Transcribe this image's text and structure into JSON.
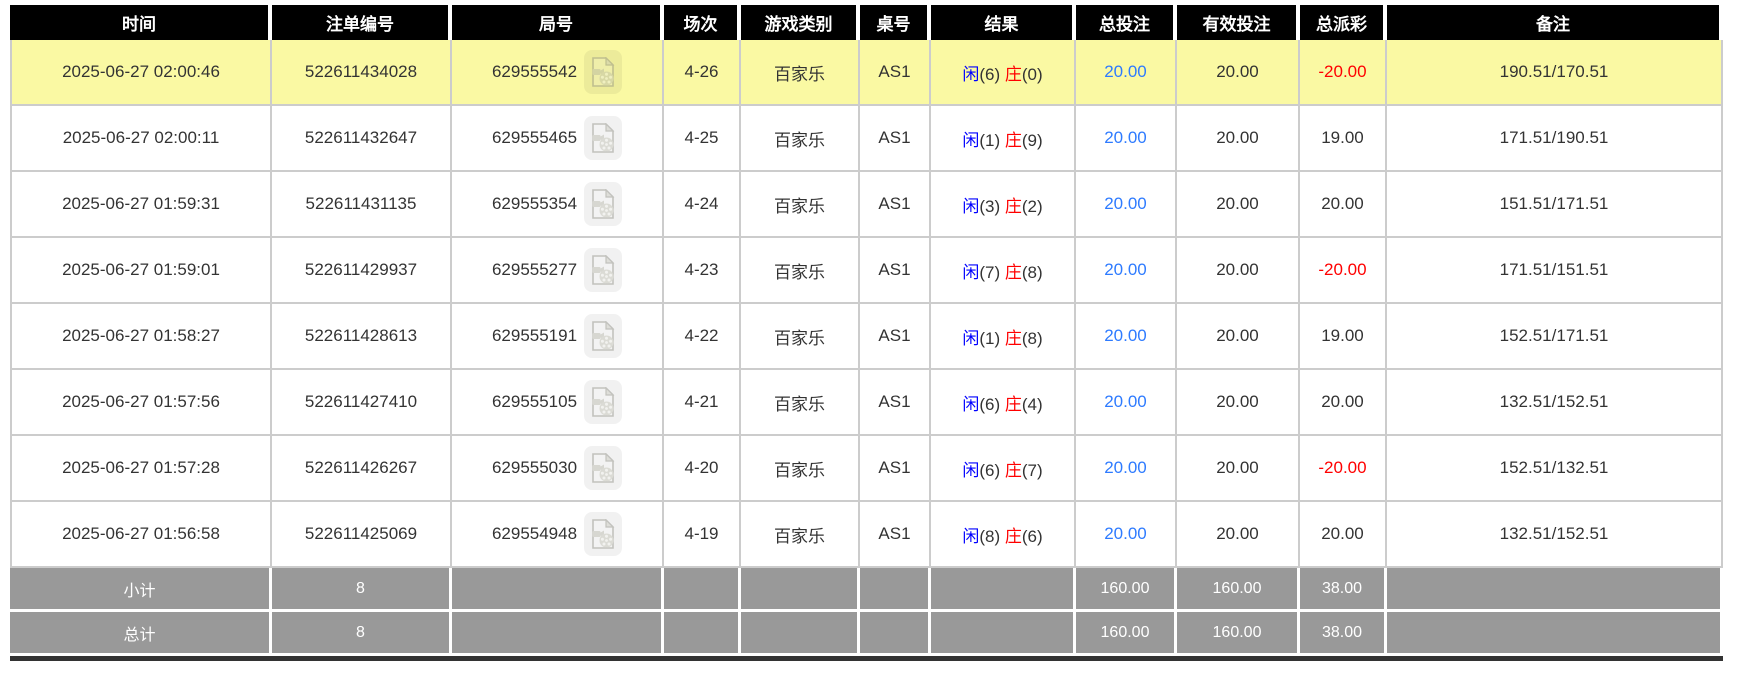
{
  "table": {
    "columns": [
      "时间",
      "注单编号",
      "局号",
      "场次",
      "游戏类别",
      "桌号",
      "结果",
      "总投注",
      "有效投注",
      "总派彩",
      "备注"
    ],
    "rows": [
      {
        "time": "2025-06-27 02:00:46",
        "bet_id": "522611434028",
        "round": "629555542",
        "session": "4-26",
        "game": "百家乐",
        "table_no": "AS1",
        "result": {
          "player_label": "闲",
          "player_score": "6",
          "banker_label": "庄",
          "banker_score": "0"
        },
        "total_bet": "20.00",
        "valid_bet": "20.00",
        "payout": "-20.00",
        "remark": "190.51/170.51",
        "highlighted": true
      },
      {
        "time": "2025-06-27 02:00:11",
        "bet_id": "522611432647",
        "round": "629555465",
        "session": "4-25",
        "game": "百家乐",
        "table_no": "AS1",
        "result": {
          "player_label": "闲",
          "player_score": "1",
          "banker_label": "庄",
          "banker_score": "9"
        },
        "total_bet": "20.00",
        "valid_bet": "20.00",
        "payout": "19.00",
        "remark": "171.51/190.51",
        "highlighted": false
      },
      {
        "time": "2025-06-27 01:59:31",
        "bet_id": "522611431135",
        "round": "629555354",
        "session": "4-24",
        "game": "百家乐",
        "table_no": "AS1",
        "result": {
          "player_label": "闲",
          "player_score": "3",
          "banker_label": "庄",
          "banker_score": "2"
        },
        "total_bet": "20.00",
        "valid_bet": "20.00",
        "payout": "20.00",
        "remark": "151.51/171.51",
        "highlighted": false
      },
      {
        "time": "2025-06-27 01:59:01",
        "bet_id": "522611429937",
        "round": "629555277",
        "session": "4-23",
        "game": "百家乐",
        "table_no": "AS1",
        "result": {
          "player_label": "闲",
          "player_score": "7",
          "banker_label": "庄",
          "banker_score": "8"
        },
        "total_bet": "20.00",
        "valid_bet": "20.00",
        "payout": "-20.00",
        "remark": "171.51/151.51",
        "highlighted": false
      },
      {
        "time": "2025-06-27 01:58:27",
        "bet_id": "522611428613",
        "round": "629555191",
        "session": "4-22",
        "game": "百家乐",
        "table_no": "AS1",
        "result": {
          "player_label": "闲",
          "player_score": "1",
          "banker_label": "庄",
          "banker_score": "8"
        },
        "total_bet": "20.00",
        "valid_bet": "20.00",
        "payout": "19.00",
        "remark": "152.51/171.51",
        "highlighted": false
      },
      {
        "time": "2025-06-27 01:57:56",
        "bet_id": "522611427410",
        "round": "629555105",
        "session": "4-21",
        "game": "百家乐",
        "table_no": "AS1",
        "result": {
          "player_label": "闲",
          "player_score": "6",
          "banker_label": "庄",
          "banker_score": "4"
        },
        "total_bet": "20.00",
        "valid_bet": "20.00",
        "payout": "20.00",
        "remark": "132.51/152.51",
        "highlighted": false
      },
      {
        "time": "2025-06-27 01:57:28",
        "bet_id": "522611426267",
        "round": "629555030",
        "session": "4-20",
        "game": "百家乐",
        "table_no": "AS1",
        "result": {
          "player_label": "闲",
          "player_score": "6",
          "banker_label": "庄",
          "banker_score": "7"
        },
        "total_bet": "20.00",
        "valid_bet": "20.00",
        "payout": "-20.00",
        "remark": "152.51/132.51",
        "highlighted": false
      },
      {
        "time": "2025-06-27 01:56:58",
        "bet_id": "522611425069",
        "round": "629554948",
        "session": "4-19",
        "game": "百家乐",
        "table_no": "AS1",
        "result": {
          "player_label": "闲",
          "player_score": "8",
          "banker_label": "庄",
          "banker_score": "6"
        },
        "total_bet": "20.00",
        "valid_bet": "20.00",
        "payout": "20.00",
        "remark": "132.51/152.51",
        "highlighted": false
      }
    ],
    "summary_rows": [
      {
        "name": "subtotal",
        "cells": [
          "小计",
          "8",
          "",
          "",
          "",
          "",
          "",
          "160.00",
          "160.00",
          "38.00",
          ""
        ]
      },
      {
        "name": "total",
        "cells": [
          "总计",
          "8",
          "",
          "",
          "",
          "",
          "",
          "160.00",
          "160.00",
          "38.00",
          ""
        ]
      }
    ]
  },
  "icons": {
    "round_video": "video-record-icon"
  },
  "colors": {
    "header_bg": "#000000",
    "header_text": "#ffffff",
    "highlight_row_bg": "#faf9a3",
    "summary_row_bg": "#999999",
    "player_blue": "#0000ff",
    "banker_red": "#ff0000",
    "bet_amount_blue": "#2e7bff",
    "negative_red": "#ff0000",
    "row_border": "#cccccc",
    "bottom_bar": "#333333"
  }
}
